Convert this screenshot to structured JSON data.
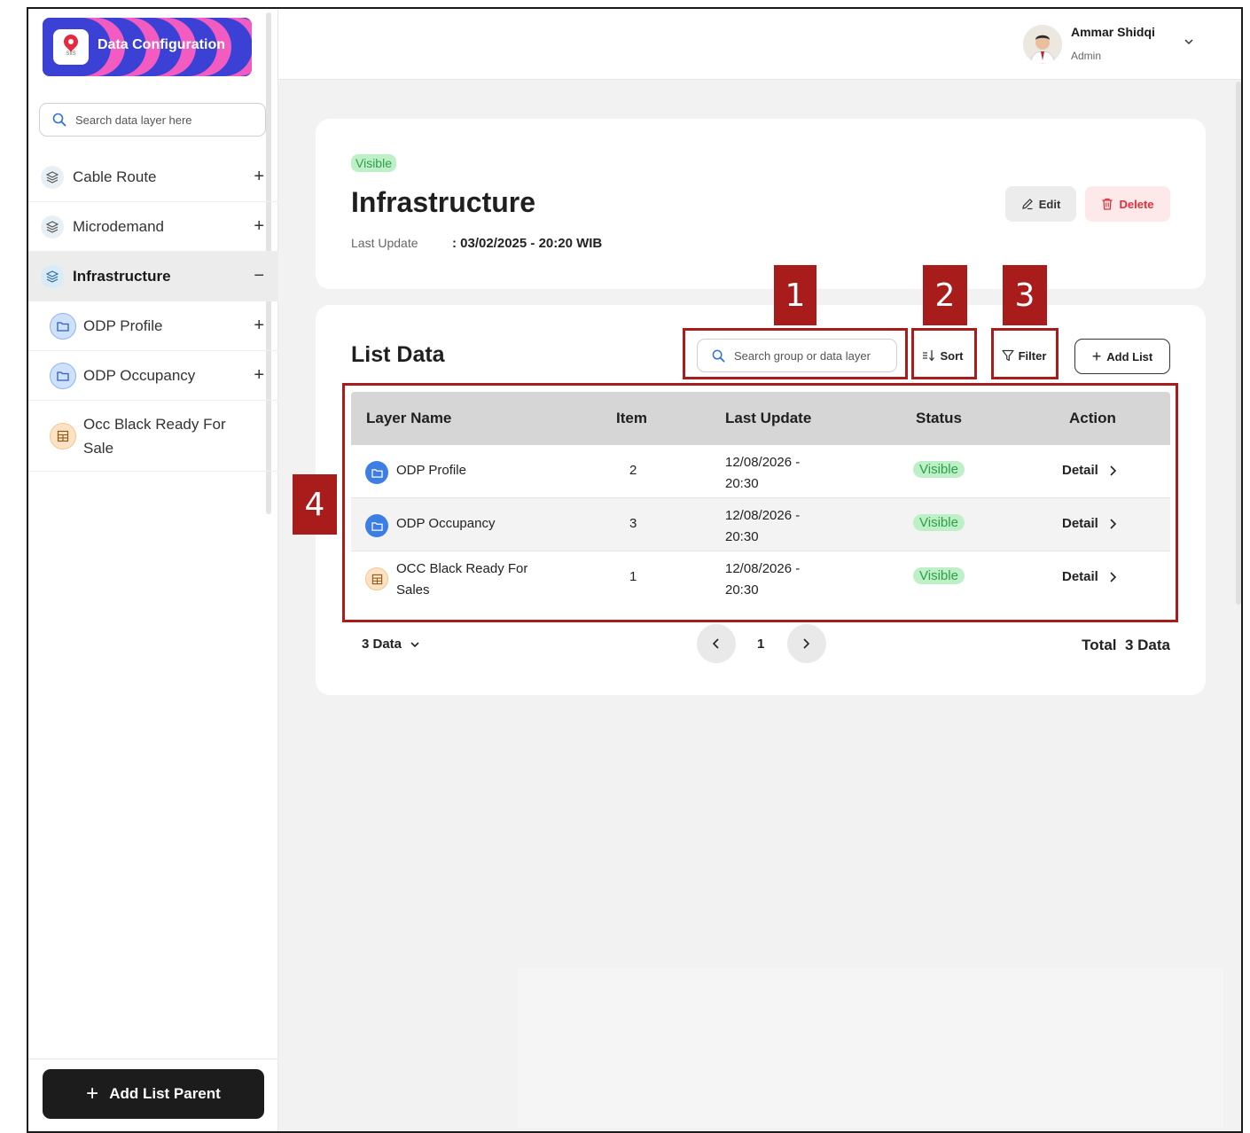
{
  "sidebar": {
    "brand_title": "Data Configuration",
    "brand_sub": "SIIS",
    "search_placeholder": "Search data layer here",
    "items": [
      {
        "label": "Cable Route",
        "toggle": "+"
      },
      {
        "label": "Microdemand",
        "toggle": "+"
      },
      {
        "label": "Infrastructure",
        "toggle": "−"
      },
      {
        "label": "ODP Profile",
        "toggle": "+"
      },
      {
        "label": "ODP Occupancy",
        "toggle": "+"
      },
      {
        "label": "Occ Black Ready For Sale"
      }
    ],
    "add_parent_label": "Add List Parent"
  },
  "header": {
    "user_name": "Ammar Shidqi",
    "user_role": "Admin"
  },
  "detail": {
    "status_badge": "Visible",
    "title": "Infrastructure",
    "last_update_label": "Last Update",
    "last_update_value": ": 03/02/2025 - 20:20 WIB",
    "edit_label": "Edit",
    "delete_label": "Delete"
  },
  "list": {
    "title": "List Data",
    "search_placeholder": "Search group or data layer",
    "sort_label": "Sort",
    "filter_label": "Filter",
    "add_label": "Add List",
    "columns": [
      "Layer Name",
      "Item",
      "Last Update",
      "Status",
      "Action"
    ],
    "rows": [
      {
        "name": "ODP Profile",
        "item": "2",
        "date": "12/08/2026 - 20:30",
        "status": "Visible",
        "action": "Detail"
      },
      {
        "name": "ODP Occupancy",
        "item": "3",
        "date": "12/08/2026 - 20:30",
        "status": "Visible",
        "action": "Detail"
      },
      {
        "name": "OCC Black Ready For Sales",
        "item": "1",
        "date": "12/08/2026 - 20:30",
        "status": "Visible",
        "action": "Detail"
      }
    ],
    "page_size": "3 Data",
    "current_page": "1",
    "total_label": "Total",
    "total_value": "3 Data"
  },
  "annotations": [
    "1",
    "2",
    "3",
    "4"
  ],
  "colors": {
    "brand_bg": "#3c41d6",
    "brand_accent": "#f25cc0",
    "visible_bg": "#bdf0c6",
    "visible_text": "#2f9e4a",
    "delete_text": "#e2303b",
    "annotation": "#a81c1c"
  },
  "icons": {
    "layer": "layers-icon",
    "folder": "folder-icon",
    "table": "table-icon",
    "search": "search-icon",
    "sort": "sort-icon",
    "filter": "filter-icon",
    "edit": "pencil-icon",
    "delete": "trash-icon"
  }
}
